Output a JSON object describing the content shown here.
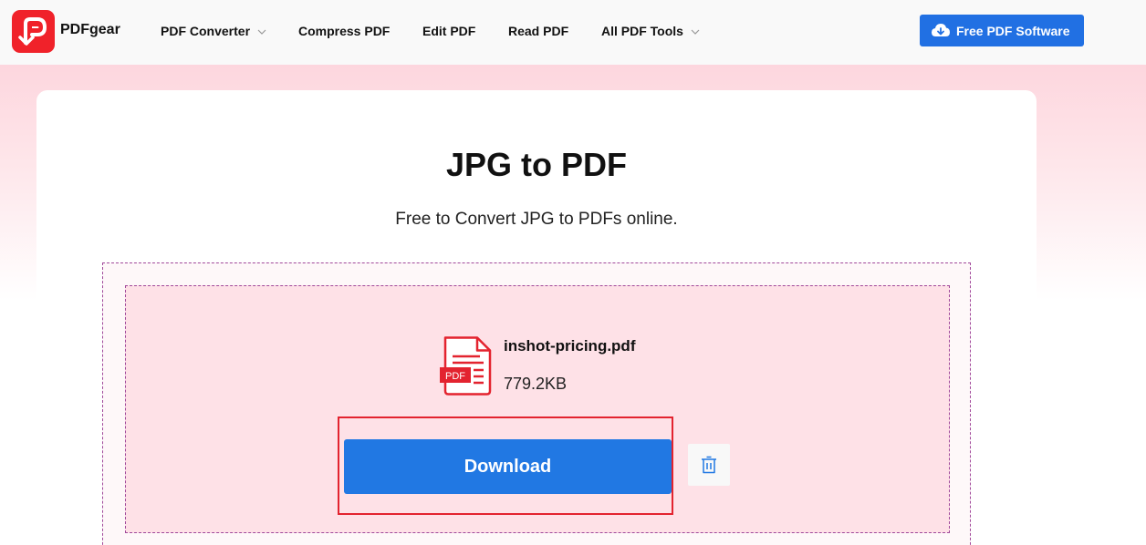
{
  "header": {
    "brand": "PDFgear",
    "nav": [
      {
        "label": "PDF Converter",
        "has_dropdown": true
      },
      {
        "label": "Compress PDF",
        "has_dropdown": false
      },
      {
        "label": "Edit PDF",
        "has_dropdown": false
      },
      {
        "label": "Read PDF",
        "has_dropdown": false
      },
      {
        "label": "All PDF Tools",
        "has_dropdown": true
      }
    ],
    "cta_label": "Free PDF Software",
    "cta_icon": "cloud-download-icon"
  },
  "main": {
    "title": "JPG to PDF",
    "subtitle": "Free to Convert JPG to PDFs online."
  },
  "file": {
    "name": "inshot-pricing.pdf",
    "size": "779.2KB",
    "icon_badge": "PDF",
    "icon": "pdf-file-icon"
  },
  "actions": {
    "download_label": "Download",
    "delete_icon": "trash-icon"
  },
  "colors": {
    "brand_red": "#f0222a",
    "primary_blue": "#2178e3",
    "highlight_red": "#e3232f",
    "dropzone_border": "#a0489a"
  }
}
